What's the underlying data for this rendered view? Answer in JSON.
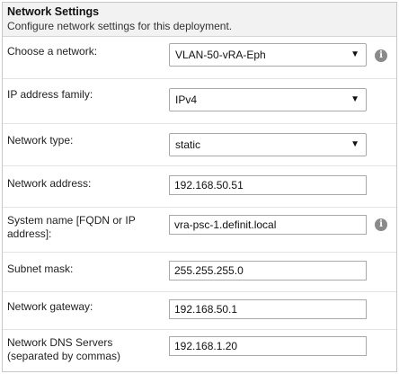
{
  "header": {
    "title": "Network Settings",
    "subtitle": "Configure network settings for this deployment."
  },
  "fields": {
    "network": {
      "label": "Choose a network:",
      "value": "VLAN-50-vRA-Eph",
      "info_icon": "info-icon"
    },
    "ip_family": {
      "label": "IP address family:",
      "value": "IPv4"
    },
    "network_type": {
      "label": "Network type:",
      "value": "static"
    },
    "network_address": {
      "label": "Network address:",
      "value": "192.168.50.51"
    },
    "system_name": {
      "label": "System name [FQDN or IP address]:",
      "value": "vra-psc-1.definit.local",
      "info_icon": "info-icon"
    },
    "subnet_mask": {
      "label": "Subnet mask:",
      "value": "255.255.255.0"
    },
    "gateway": {
      "label": "Network gateway:",
      "value": "192.168.50.1"
    },
    "dns": {
      "label": "Network DNS Servers (separated by commas)",
      "value": "192.168.1.20"
    }
  },
  "icons": {
    "dropdown": "▼",
    "info": "i"
  }
}
